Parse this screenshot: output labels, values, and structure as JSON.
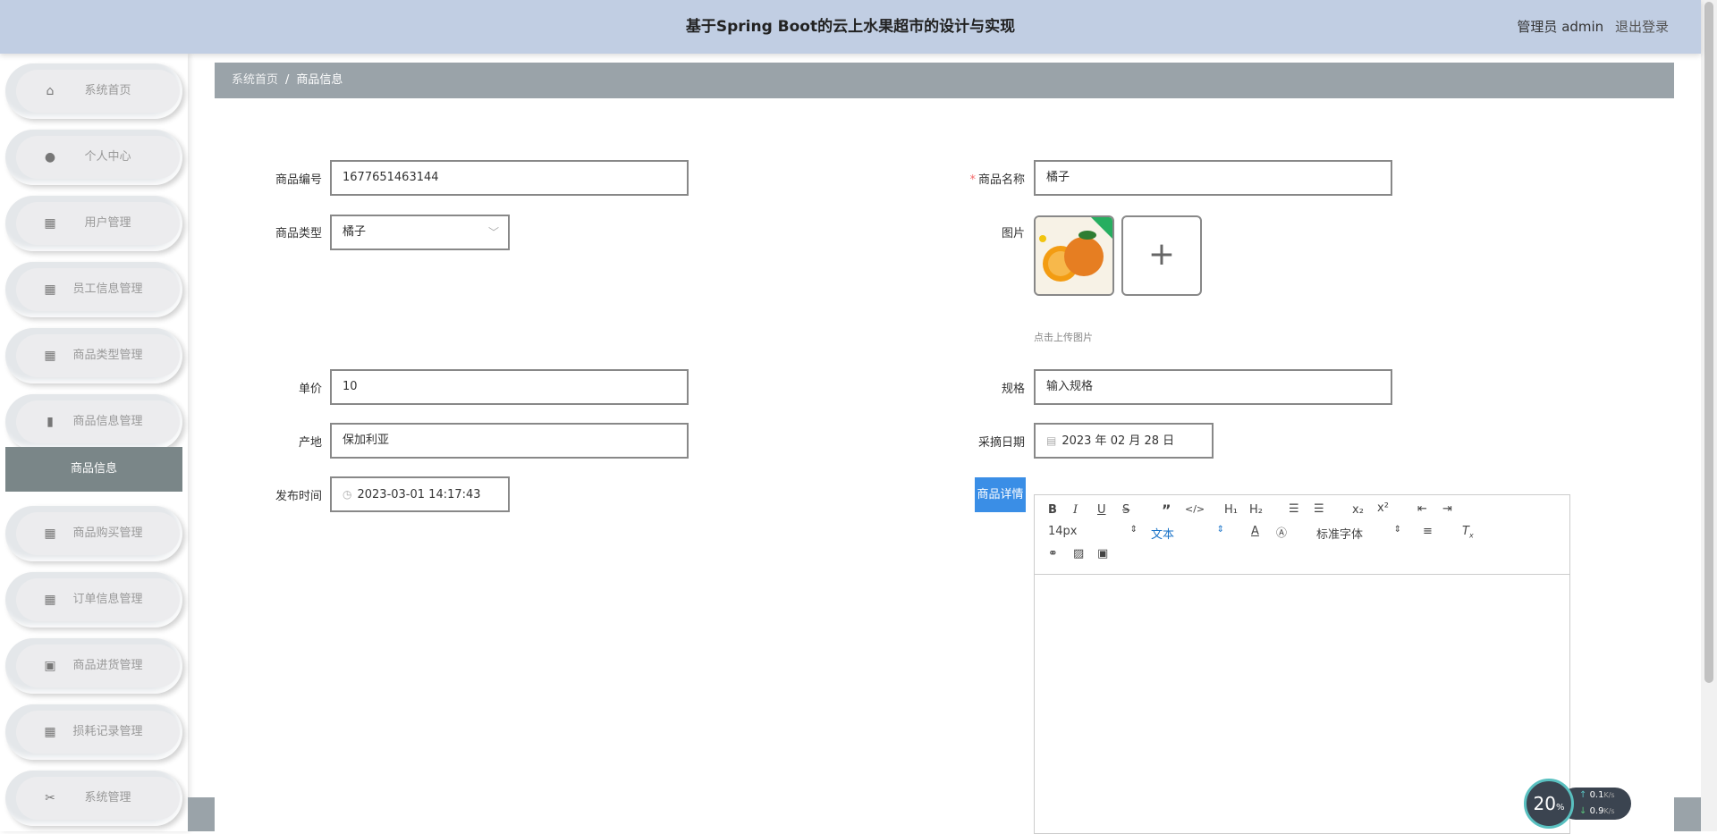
{
  "header": {
    "title": "基于Spring Boot的云上水果超市的设计与实现",
    "role_user": "管理员 admin",
    "logout": "退出登录"
  },
  "sidebar": {
    "items": [
      {
        "label": "系统首页",
        "icon": "home-icon"
      },
      {
        "label": "个人中心",
        "icon": "user-icon"
      },
      {
        "label": "用户管理",
        "icon": "grid-icon"
      },
      {
        "label": "员工信息管理",
        "icon": "grid-icon"
      },
      {
        "label": "商品类型管理",
        "icon": "grid-icon"
      },
      {
        "label": "商品信息管理",
        "icon": "chart-icon"
      },
      {
        "label": "商品购买管理",
        "icon": "grid-icon"
      },
      {
        "label": "订单信息管理",
        "icon": "grid-icon"
      },
      {
        "label": "商品进货管理",
        "icon": "clipboard-icon"
      },
      {
        "label": "损耗记录管理",
        "icon": "grid-icon"
      },
      {
        "label": "系统管理",
        "icon": "ticket-icon"
      }
    ],
    "submenu_active": "商品信息"
  },
  "breadcrumb": {
    "home": "系统首页",
    "separator": "/",
    "current": "商品信息"
  },
  "form": {
    "code_label": "商品编号",
    "code_value": "1677651463144",
    "name_label": "商品名称",
    "name_value": "橘子",
    "type_label": "商品类型",
    "type_value": "橘子",
    "image_label": "图片",
    "upload_tip": "点击上传图片",
    "price_label": "单价",
    "price_value": "10",
    "spec_label": "规格",
    "spec_value": "输入规格",
    "origin_label": "产地",
    "origin_value": "保加利亚",
    "pick_date_label": "采摘日期",
    "pick_date_value": "2023 年 02 月 28 日",
    "publish_label": "发布时间",
    "publish_value": "2023-03-01 14:17:43",
    "detail_label": "商品详情"
  },
  "editor": {
    "font_size": "14px",
    "header_select": "文本",
    "font_family": "标准字体"
  },
  "speed": {
    "percent": "20",
    "percent_unit": "%",
    "up": "0.1",
    "down": "0.9",
    "unit": "K/s"
  },
  "colors": {
    "header_bg": "#c1cee3",
    "breadcrumb_bg": "#9aa3a9",
    "submenu_active_bg": "#7a8688",
    "primary_button": "#3a8ee6"
  }
}
